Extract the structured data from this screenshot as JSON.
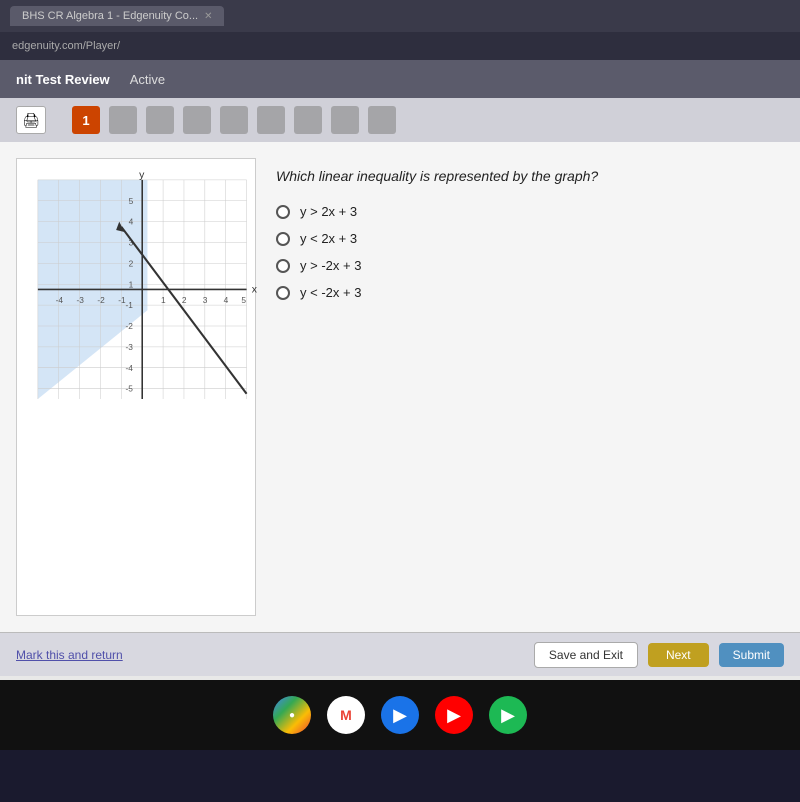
{
  "browser": {
    "tab_label": "BHS CR Algebra 1 - Edgenuity Co...",
    "address": "edgenuity.com/Player/"
  },
  "nav": {
    "title": "nit Test Review",
    "status": "Active"
  },
  "question_bar": {
    "current_question": "1"
  },
  "question": {
    "text": "Which linear inequality is represented by the graph?",
    "options": [
      {
        "id": "a",
        "label": "y > 2x + 3"
      },
      {
        "id": "b",
        "label": "y < 2x + 3"
      },
      {
        "id": "c",
        "label": "y > -2x + 3"
      },
      {
        "id": "d",
        "label": "y < -2x + 3"
      }
    ]
  },
  "actions": {
    "mark_return": "Mark this and return",
    "save_exit": "Save and Exit",
    "next": "Next",
    "submit": "Submit"
  },
  "icons": {
    "print": "🖨",
    "chrome": "⊙",
    "gmail": "M",
    "play1": "▶",
    "play2": "▶",
    "play3": "▶"
  }
}
